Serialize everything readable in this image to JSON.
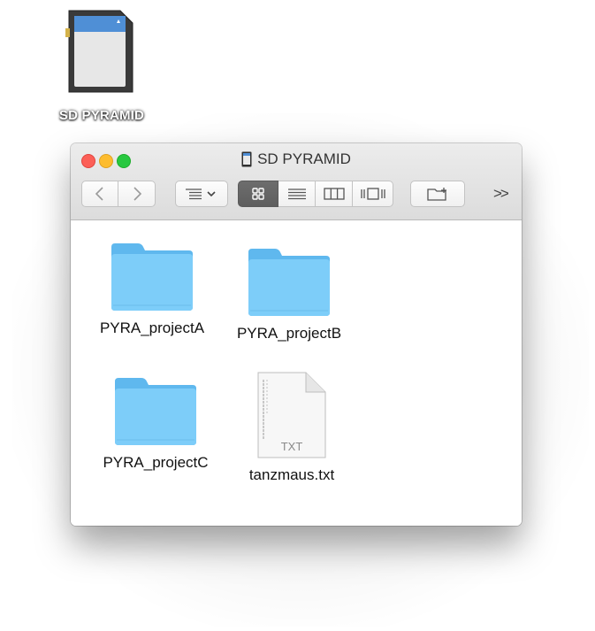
{
  "desktop": {
    "volume_label": "SD PYRAMID",
    "volume_icon": "sd-card-icon"
  },
  "window": {
    "title": "SD PYRAMID",
    "title_icon": "sd-card-small-icon",
    "toolbar": {
      "back_icon": "chevron-left-icon",
      "forward_icon": "chevron-right-icon",
      "arrange_icon": "arrange-menu-icon",
      "view_icons": "icon-view-icon",
      "view_list": "list-view-icon",
      "view_columns": "column-view-icon",
      "view_coverflow": "cover-flow-icon",
      "new_folder_icon": "new-folder-icon",
      "overflow_label": ">>"
    },
    "items": [
      {
        "name": "PYRA_projectA",
        "kind": "folder"
      },
      {
        "name": "PYRA_projectB",
        "kind": "folder"
      },
      {
        "name": "PYRA_projectC",
        "kind": "folder"
      },
      {
        "name": "tanzmaus.txt",
        "kind": "text-file",
        "badge": "TXT"
      }
    ]
  },
  "colors": {
    "folder": "#6cc4f5",
    "close": "#fc5f57",
    "minimize": "#fdbc2e",
    "zoom": "#28c840"
  }
}
